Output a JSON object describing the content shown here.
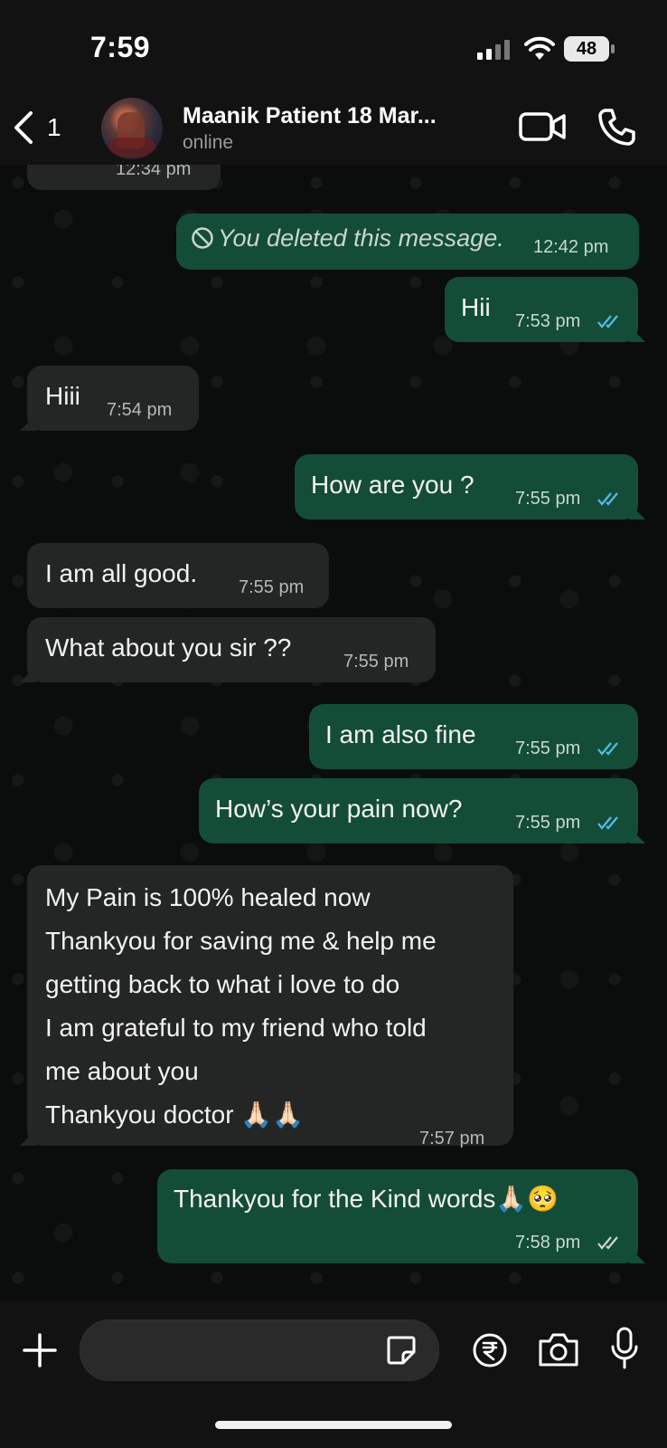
{
  "status_bar": {
    "time": "7:59",
    "battery": "48"
  },
  "header": {
    "back_count": "1",
    "contact_name": "Maanik Patient 18 Mar...",
    "contact_status": "online"
  },
  "messages": [
    {
      "dir": "in",
      "text": "",
      "time": "12:34 pm"
    },
    {
      "dir": "out",
      "text": "You deleted this message.",
      "time": "12:42 pm",
      "deleted": true
    },
    {
      "dir": "out",
      "text": "Hii",
      "time": "7:53 pm",
      "read": true
    },
    {
      "dir": "in",
      "text": "Hiii",
      "time": "7:54 pm"
    },
    {
      "dir": "out",
      "text": "How are you ?",
      "time": "7:55 pm",
      "read": true
    },
    {
      "dir": "in",
      "text": "I am all good.",
      "time": "7:55 pm"
    },
    {
      "dir": "in",
      "text": "What about you sir ??",
      "time": "7:55 pm"
    },
    {
      "dir": "out",
      "text": "I am also fine",
      "time": "7:55 pm",
      "read": true
    },
    {
      "dir": "out",
      "text": "How’s your pain now?",
      "time": "7:55 pm",
      "read": true
    },
    {
      "dir": "in",
      "lines": [
        "My Pain is 100% healed now",
        "Thankyou for saving me & help me",
        "getting back to what i love to do",
        "I am grateful to my friend who told",
        "me about you",
        "Thankyou doctor 🙏🏻🙏🏻"
      ],
      "time": "7:57 pm"
    },
    {
      "dir": "out",
      "text": "Thankyou for the Kind words🙏🏻🥺",
      "time": "7:58 pm",
      "read": false
    }
  ],
  "colors": {
    "incoming": "#242626",
    "outgoing": "#144d37",
    "read_ticks": "#53bdeb",
    "background": "#0b0c0c"
  },
  "icons": [
    "back-chevron-icon",
    "video-call-icon",
    "voice-call-icon",
    "plus-icon",
    "sticker-icon",
    "rupee-payment-icon",
    "camera-icon",
    "microphone-icon"
  ]
}
